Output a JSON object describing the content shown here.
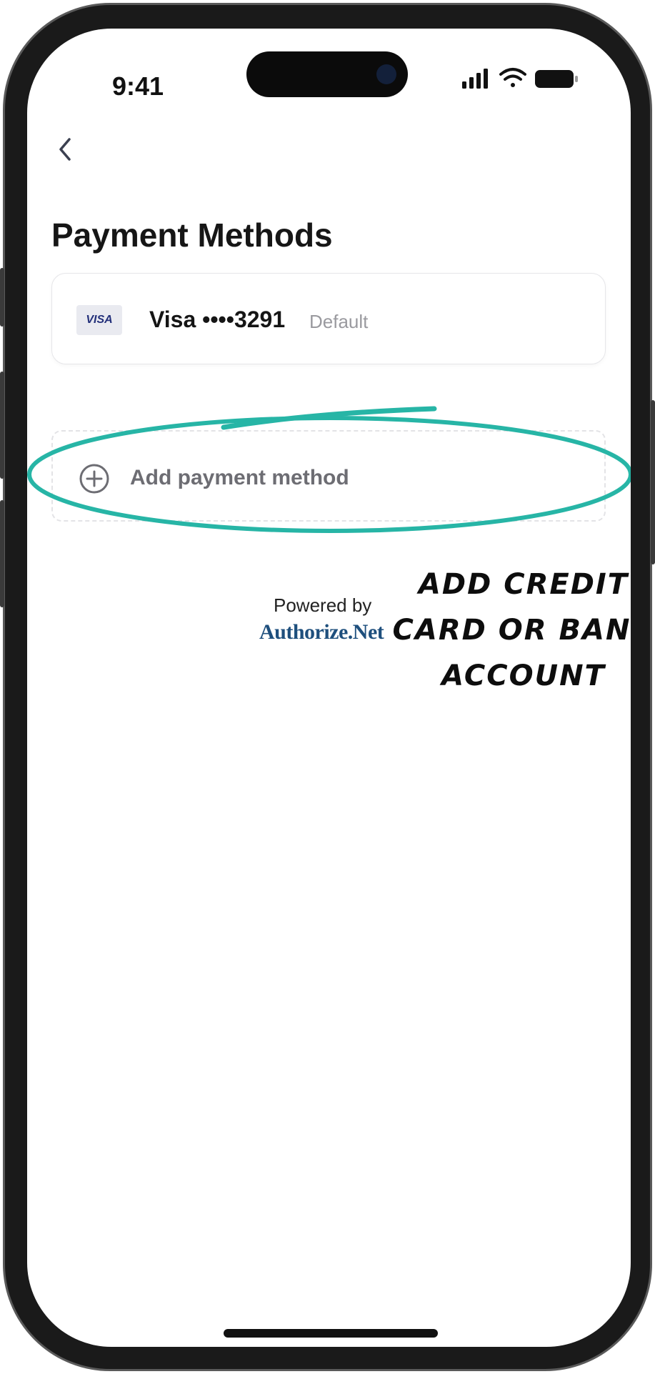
{
  "status_bar": {
    "time": "9:41",
    "icons": [
      "signal-icon",
      "wifi-icon",
      "battery-icon"
    ]
  },
  "nav": {
    "back_icon": "chevron-left-icon"
  },
  "page": {
    "title": "Payment Methods"
  },
  "payment_methods": [
    {
      "brand": "VISA",
      "label": "Visa ••••3291",
      "tag": "Default"
    }
  ],
  "add_method": {
    "label": "Add payment method",
    "icon": "plus-circle-icon"
  },
  "footer": {
    "powered_by": "Powered by",
    "provider": "Authorize.Net"
  },
  "annotation": {
    "lines": [
      "ADD CREDIT",
      "CARD OR BANK",
      "ACCOUNT"
    ],
    "color": "#27b5a6"
  },
  "colors": {
    "accent": "#27b5a6",
    "title": "#161616",
    "muted": "#9a9a9f",
    "logo": "#1e4f7d"
  }
}
